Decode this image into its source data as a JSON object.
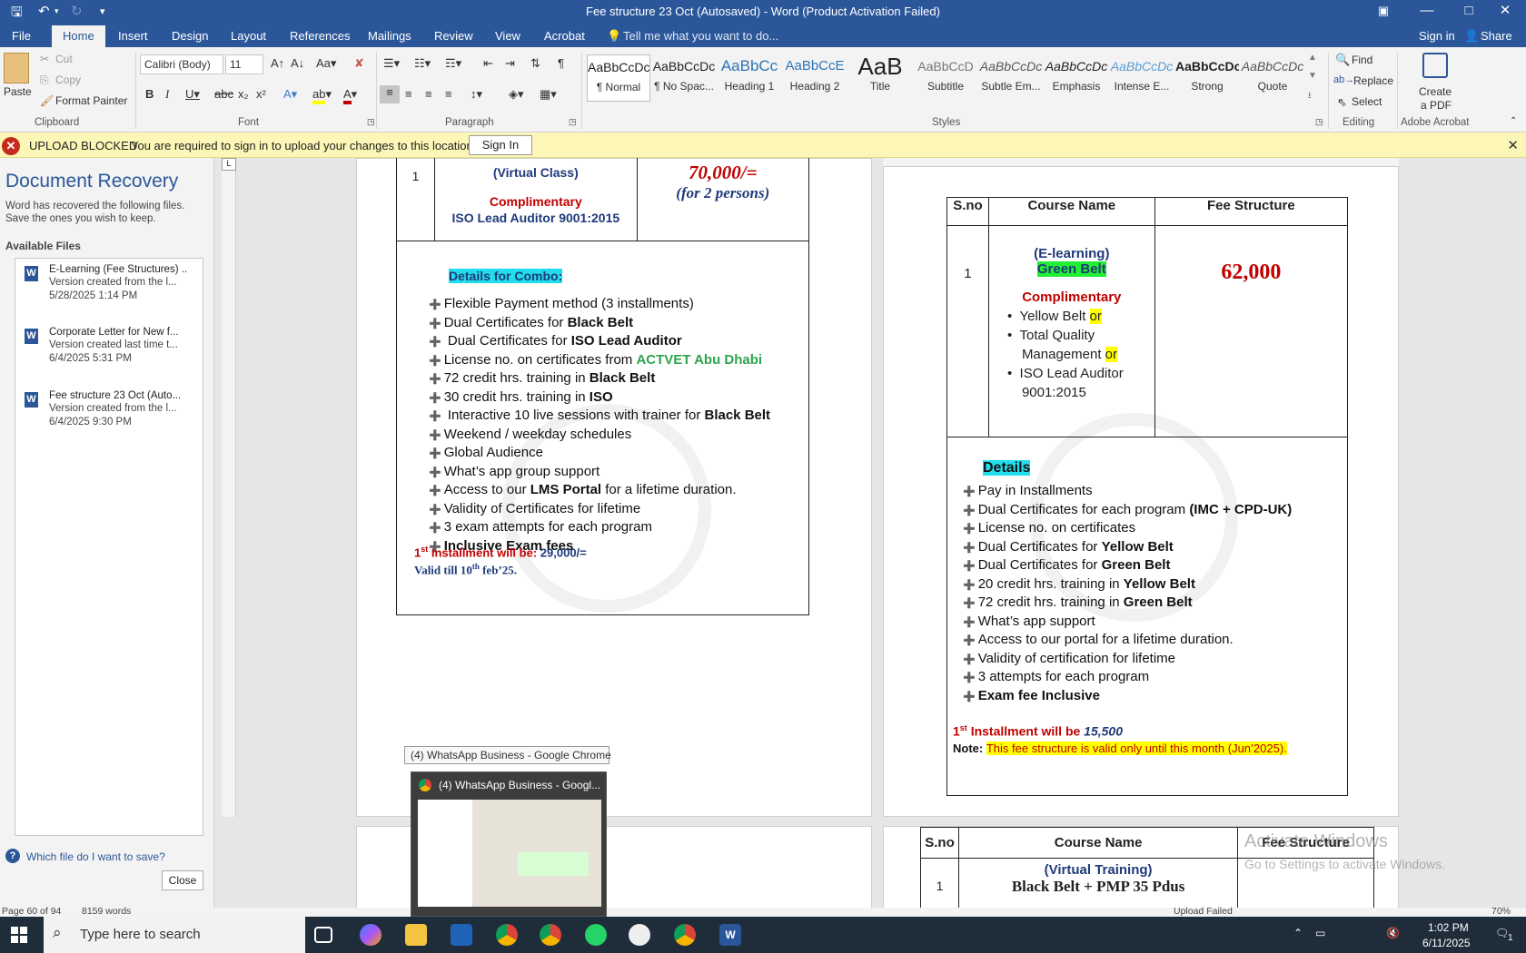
{
  "window": {
    "title": "Fee structure 23 Oct (Autosaved) - Word (Product Activation Failed)"
  },
  "tabs": [
    {
      "label": "File"
    },
    {
      "label": "Home"
    },
    {
      "label": "Insert"
    },
    {
      "label": "Design"
    },
    {
      "label": "Layout"
    },
    {
      "label": "References"
    },
    {
      "label": "Mailings"
    },
    {
      "label": "Review"
    },
    {
      "label": "View"
    },
    {
      "label": "Acrobat"
    }
  ],
  "tell_me": "Tell me what you want to do...",
  "signin": "Sign in",
  "share": "Share",
  "ribbon": {
    "clipboard": {
      "paste": "Paste",
      "cut": "Cut",
      "copy": "Copy",
      "format_painter": "Format Painter",
      "label": "Clipboard"
    },
    "font": {
      "name": "Calibri (Body)",
      "size": "11",
      "label": "Font"
    },
    "paragraph": {
      "label": "Paragraph"
    },
    "styles": {
      "label": "Styles",
      "items": [
        {
          "preview": "AaBbCcDc",
          "name": "¶ Normal"
        },
        {
          "preview": "AaBbCcDc",
          "name": "¶ No Spac..."
        },
        {
          "preview": "AaBbCc",
          "name": "Heading 1"
        },
        {
          "preview": "AaBbCcE",
          "name": "Heading 2"
        },
        {
          "preview": "AaB",
          "name": "Title"
        },
        {
          "preview": "AaBbCcD",
          "name": "Subtitle"
        },
        {
          "preview": "AaBbCcDc",
          "name": "Subtle Em..."
        },
        {
          "preview": "AaBbCcDc",
          "name": "Emphasis"
        },
        {
          "preview": "AaBbCcDc",
          "name": "Intense E..."
        },
        {
          "preview": "AaBbCcDc",
          "name": "Strong"
        },
        {
          "preview": "AaBbCcDc",
          "name": "Quote"
        }
      ]
    },
    "editing": {
      "find": "Find",
      "replace": "Replace",
      "select": "Select",
      "label": "Editing"
    },
    "acrobat": {
      "create1": "Create",
      "create2": "a PDF",
      "label": "Adobe Acrobat"
    }
  },
  "message_bar": {
    "heading": "UPLOAD BLOCKED",
    "text": "You are required to sign in to upload your changes to this location.",
    "button": "Sign In"
  },
  "recovery": {
    "title": "Document Recovery",
    "intro": "Word has recovered the following files. Save the ones you wish to keep.",
    "available": "Available Files",
    "files": [
      {
        "name": "E-Learning (Fee Structures) ..",
        "desc": "Version created from the l...",
        "date": "5/28/2025 1:14 PM"
      },
      {
        "name": "Corporate Letter for New f...",
        "desc": "Version created last time t...",
        "date": "6/4/2025 5:31 PM"
      },
      {
        "name": "Fee structure 23 Oct (Auto...",
        "desc": "Version created from the l...",
        "date": "6/4/2025 9:30 PM"
      }
    ],
    "help": "Which file do I want to save?",
    "close": "Close"
  },
  "left_page": {
    "row_no": "1",
    "virtual": "(Virtual Class)",
    "comp": "Complimentary",
    "iso": "ISO Lead Auditor 9001:2015",
    "price": "70,000/=",
    "persons": "(for 2 persons)",
    "details_heading": "Details for Combo:",
    "bullets": [
      [
        "Flexible Payment method (3 installments)",
        ""
      ],
      [
        "Dual Certificates for ",
        "Black Belt"
      ],
      [
        " Dual Certificates for ",
        "ISO Lead Auditor"
      ],
      [
        "License no. on certificates from ",
        "ACTVET Abu Dhabi"
      ],
      [
        "72 credit hrs. training in ",
        "Black Belt"
      ],
      [
        "30 credit hrs. training in ",
        "ISO"
      ],
      [
        " Interactive 10 live sessions with trainer for ",
        "Black Belt"
      ],
      [
        "Weekend / weekday schedules",
        ""
      ],
      [
        "Global Audience",
        ""
      ],
      [
        "What’s app group support",
        ""
      ],
      [
        "Access to our ",
        "LMS Portal",
        " for a lifetime duration."
      ],
      [
        "Validity of Certificates for lifetime",
        ""
      ],
      [
        "3 exam attempts for each program",
        ""
      ],
      [
        "",
        "Inclusive Exam fees"
      ]
    ],
    "inst_sup": "st",
    "inst_a": "1",
    "inst_b": " Installment will be: ",
    "inst_amt": "29,000/=",
    "valid_a": "Valid till 10",
    "valid_sup": "th",
    "valid_b": " feb’25."
  },
  "right_page": {
    "headers": [
      "S.no",
      "Course Name",
      "Fee Structure"
    ],
    "row_no": "1",
    "elearning": "(E-learning)",
    "green_belt": "Green Belt",
    "price": "62,000",
    "comp": "Complimentary",
    "opt1a": "Yellow Belt ",
    "or": "or",
    "opt2a": "Total Quality",
    "opt2b": "Management ",
    "opt3a": "ISO Lead Auditor",
    "opt3b": "9001:2015",
    "details_heading": "Details",
    "bullets": [
      [
        "Pay in Installments",
        ""
      ],
      [
        "Dual Certificates for each program ",
        "(IMC + CPD-UK)"
      ],
      [
        "License no. on certificates",
        ""
      ],
      [
        "Dual Certificates for ",
        "Yellow Belt"
      ],
      [
        "Dual Certificates for ",
        "Green Belt"
      ],
      [
        "20 credit hrs. training in ",
        "Yellow Belt"
      ],
      [
        "72 credit hrs. training in ",
        "Green Belt"
      ],
      [
        "What’s app support",
        ""
      ],
      [
        "Access to our portal for a lifetime duration.",
        ""
      ],
      [
        "Validity of certification for lifetime",
        ""
      ],
      [
        "3 attempts for each program",
        ""
      ],
      [
        "",
        "Exam fee Inclusive"
      ]
    ],
    "inst_a": "1",
    "inst_sup": "st",
    "inst_b": " Installment will be ",
    "inst_amt": "15,500",
    "note_label": "Note: ",
    "note_text": "This fee structure is valid only until this month (Jun’2025).",
    "next_headers": [
      "S.no",
      "Course Name",
      "Fee Structure"
    ],
    "next_virtual": "(Virtual Training)",
    "next_row_no": "1",
    "next_course": "Black Belt + PMP 35 Pdus"
  },
  "activate": {
    "line1": "Activate Windows",
    "line2": "Go to Settings to activate Windows."
  },
  "status": {
    "page": "Page 60 of 94",
    "words": "8159 words",
    "upload": "Upload Failed",
    "zoom": "70%"
  },
  "chrome_tooltip": "(4) WhatsApp Business - Google Chrome",
  "chrome_thumb_title": "(4) WhatsApp Business - Googl...",
  "taskbar": {
    "search": "Type here to search",
    "time": "1:02 PM",
    "date": "6/11/2025",
    "notif": "1"
  }
}
